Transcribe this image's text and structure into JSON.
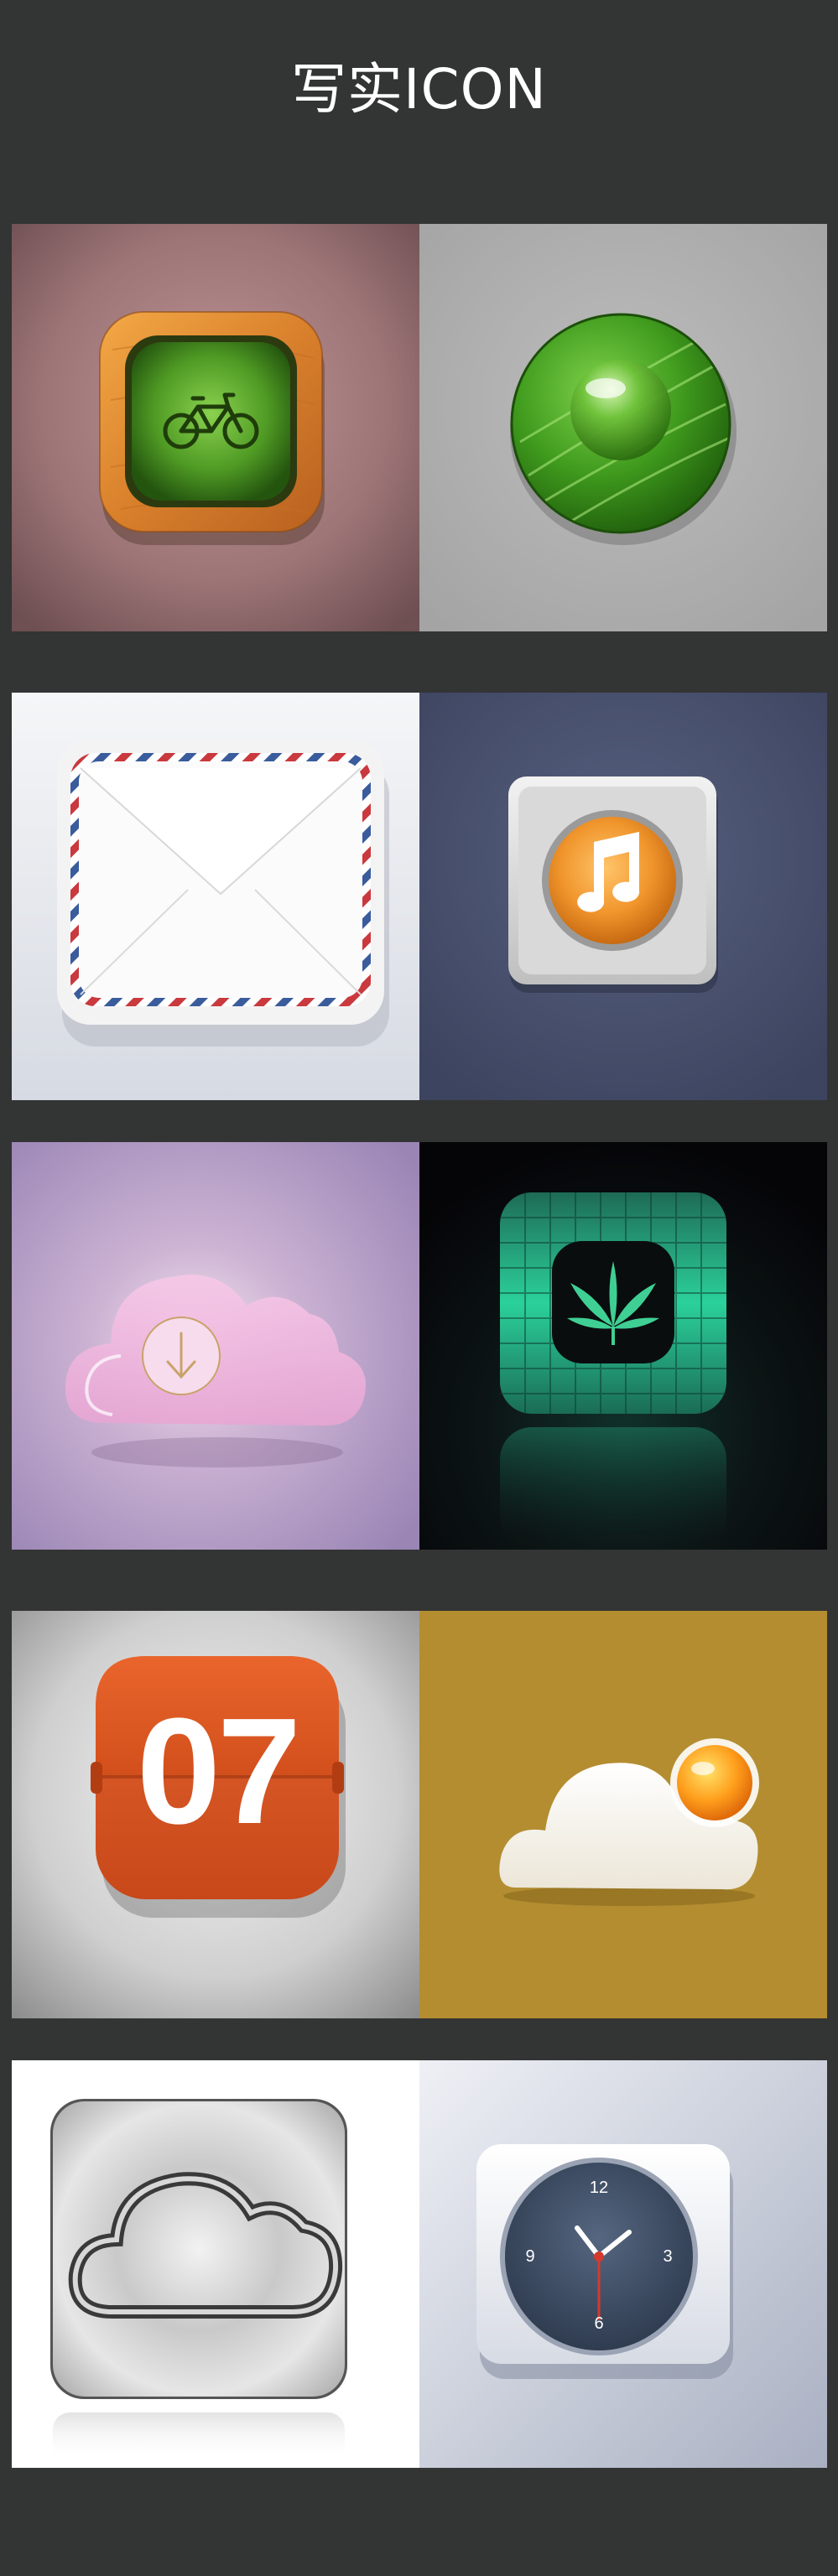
{
  "page": {
    "title": "写实ICON"
  },
  "tiles": [
    {
      "row": 1,
      "position": "left",
      "icon": "bicycle-icon",
      "background": "#9a7274"
    },
    {
      "row": 1,
      "position": "right",
      "icon": "leaf-drop-icon",
      "background": "#b0b0b0"
    },
    {
      "row": 2,
      "position": "left",
      "icon": "envelope-icon",
      "background": "#e8ebf0"
    },
    {
      "row": 2,
      "position": "right",
      "icon": "music-icon",
      "background": "#49506a"
    },
    {
      "row": 3,
      "position": "left",
      "icon": "cloud-download-icon",
      "background": "#a58fbf"
    },
    {
      "row": 3,
      "position": "right",
      "icon": "leaf-emblem-icon",
      "background": "#0b0a10"
    },
    {
      "row": 4,
      "position": "left",
      "icon": "calendar-icon",
      "background": "#c8c8c8"
    },
    {
      "row": 4,
      "position": "right",
      "icon": "cloud-sun-icon",
      "background": "#b38d30"
    },
    {
      "row": 5,
      "position": "left",
      "icon": "icloud-icon",
      "background": "#ffffff"
    },
    {
      "row": 5,
      "position": "right",
      "icon": "clock-icon",
      "background": "#c4c9d6"
    }
  ],
  "calendar": {
    "day": "07"
  },
  "clock": {
    "n12": "12",
    "n3": "3",
    "n6": "6",
    "n9": "9"
  }
}
